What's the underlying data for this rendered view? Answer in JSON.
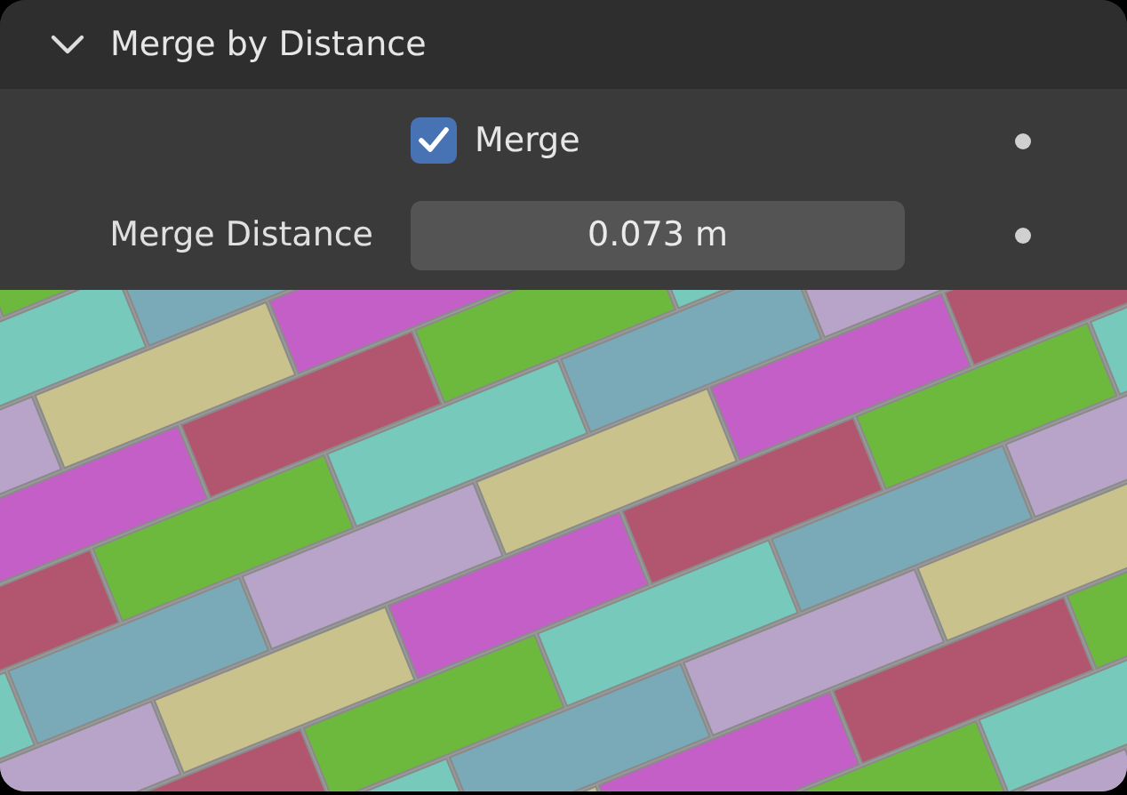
{
  "panel": {
    "title": "Merge by Distance",
    "expanded": true
  },
  "properties": [
    {
      "kind": "checkbox",
      "label": "Merge",
      "checked": true
    },
    {
      "kind": "number",
      "label": "Merge Distance",
      "value": "0.073 m"
    }
  ]
}
